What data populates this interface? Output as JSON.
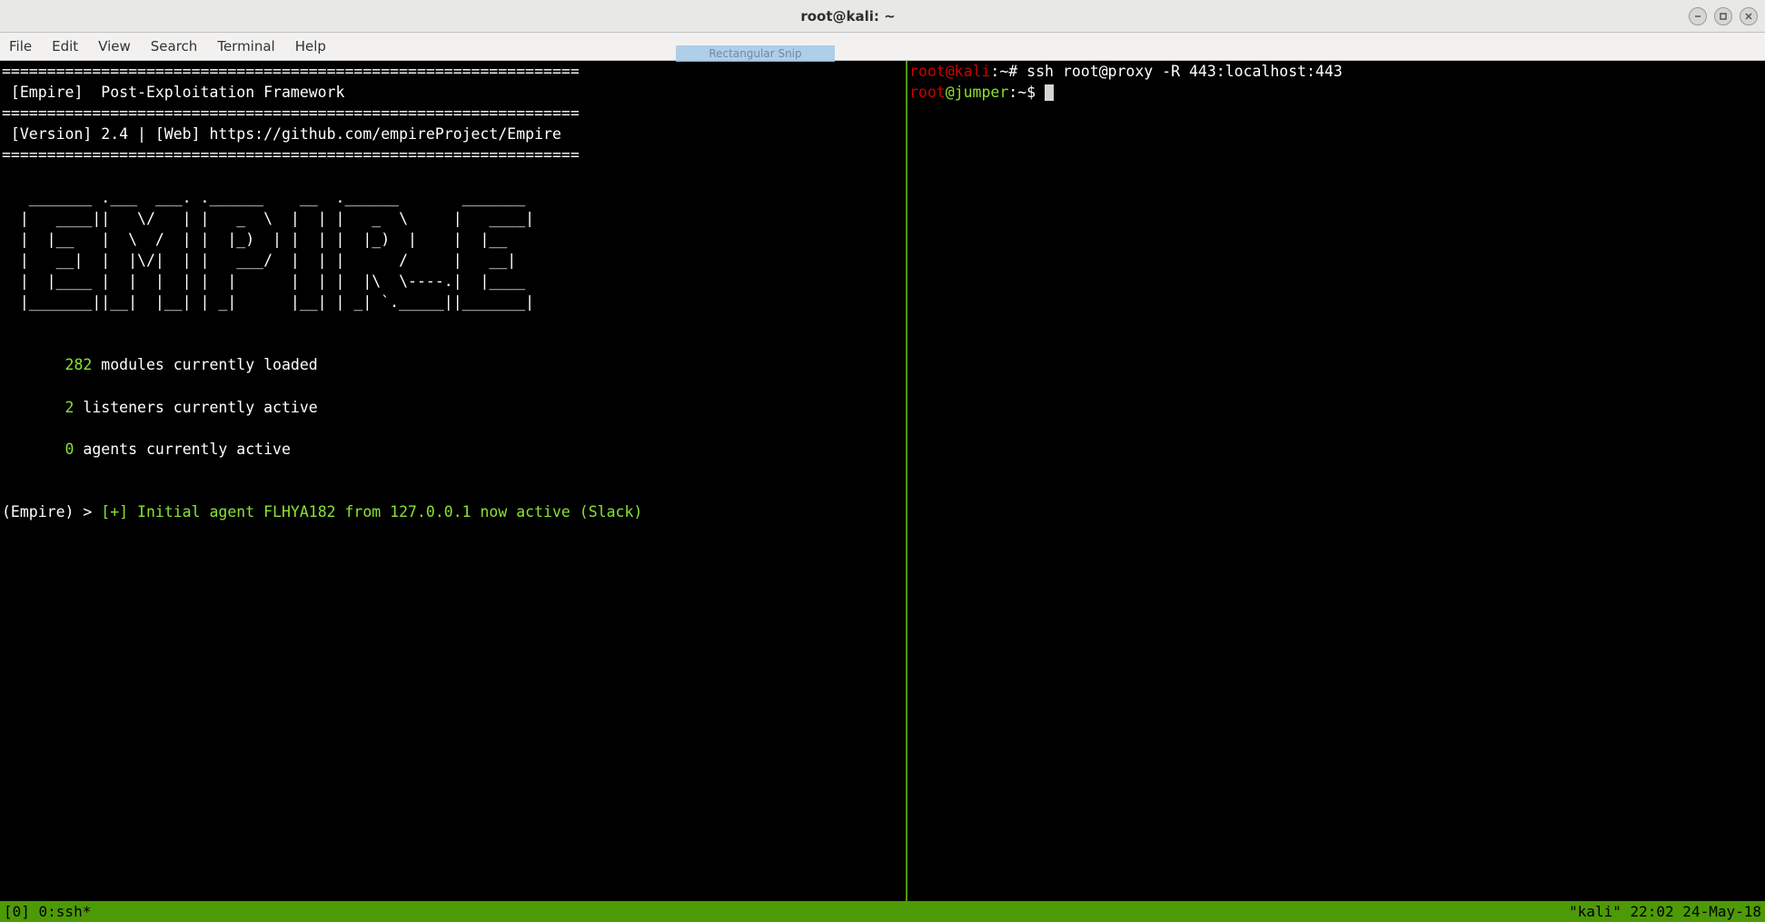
{
  "window": {
    "title": "root@kali: ~"
  },
  "menu": {
    "file": "File",
    "edit": "Edit",
    "view": "View",
    "search": "Search",
    "terminal": "Terminal",
    "help": "Help"
  },
  "snip_hint": "Rectangular Snip",
  "left_pane": {
    "border1": "================================================================",
    "header1": " [Empire]  Post-Exploitation Framework",
    "border2": "================================================================",
    "header2": " [Version] 2.4 | [Web] https://github.com/empireProject/Empire",
    "border3": "================================================================",
    "ascii1": "   _______ .___  ___. .______    __  .______       _______",
    "ascii2": "  |   ____||   \\/   | |   _  \\  |  | |   _  \\     |   ____|",
    "ascii3": "  |  |__   |  \\  /  | |  |_)  | |  | |  |_)  |    |  |__",
    "ascii4": "  |   __|  |  |\\/|  | |   ___/  |  | |      /     |   __|",
    "ascii5": "  |  |____ |  |  |  | |  |      |  | |  |\\  \\----.|  |____",
    "ascii6": "  |_______||__|  |__| | _|      |__| | _| `._____||_______|",
    "modules_count": "       282",
    "modules_text": " modules currently loaded",
    "listeners_count": "       2",
    "listeners_text": " listeners currently active",
    "agents_count": "       0",
    "agents_text": " agents currently active",
    "prompt": "(Empire) > ",
    "agent_msg": "[+] Initial agent FLHYA182 from 127.0.0.1 now active (Slack)"
  },
  "right_pane": {
    "line1_user": "root@kali",
    "line1_path": ":~# ",
    "line1_cmd": "ssh root@proxy -R 443:localhost:443",
    "line2_user": "root",
    "line2_host": "@jumper",
    "line2_rest": ":~$ "
  },
  "statusbar": {
    "left": "[0] 0:ssh*",
    "right": "\"kali\" 22:02 24-May-18"
  }
}
